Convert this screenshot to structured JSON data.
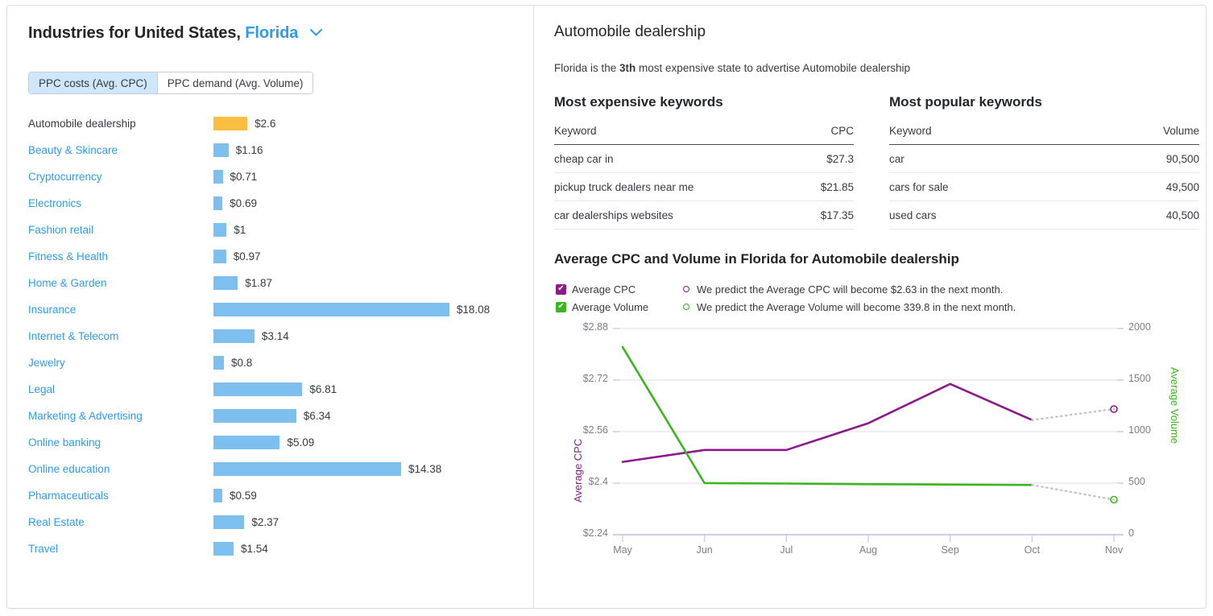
{
  "left": {
    "title_prefix": "Industries for United States,",
    "state": "Florida",
    "chevron_icon": "chevron-down-icon",
    "tabs": [
      {
        "label": "PPC costs (Avg. CPC)",
        "active": true
      },
      {
        "label": "PPC demand (Avg. Volume)",
        "active": false
      }
    ],
    "industries": [
      {
        "name": "Automobile dealership",
        "value": 2.6,
        "label": "$2.6",
        "current": true
      },
      {
        "name": "Beauty & Skincare",
        "value": 1.16,
        "label": "$1.16",
        "current": false
      },
      {
        "name": "Cryptocurrency",
        "value": 0.71,
        "label": "$0.71",
        "current": false
      },
      {
        "name": "Electronics",
        "value": 0.69,
        "label": "$0.69",
        "current": false
      },
      {
        "name": "Fashion retail",
        "value": 1,
        "label": "$1",
        "current": false
      },
      {
        "name": "Fitness & Health",
        "value": 0.97,
        "label": "$0.97",
        "current": false
      },
      {
        "name": "Home & Garden",
        "value": 1.87,
        "label": "$1.87",
        "current": false
      },
      {
        "name": "Insurance",
        "value": 18.08,
        "label": "$18.08",
        "current": false
      },
      {
        "name": "Internet & Telecom",
        "value": 3.14,
        "label": "$3.14",
        "current": false
      },
      {
        "name": "Jewelry",
        "value": 0.8,
        "label": "$0.8",
        "current": false
      },
      {
        "name": "Legal",
        "value": 6.81,
        "label": "$6.81",
        "current": false
      },
      {
        "name": "Marketing & Advertising",
        "value": 6.34,
        "label": "$6.34",
        "current": false
      },
      {
        "name": "Online banking",
        "value": 5.09,
        "label": "$5.09",
        "current": false
      },
      {
        "name": "Online education",
        "value": 14.38,
        "label": "$14.38",
        "current": false
      },
      {
        "name": "Pharmaceuticals",
        "value": 0.59,
        "label": "$0.59",
        "current": false
      },
      {
        "name": "Real Estate",
        "value": 2.37,
        "label": "$2.37",
        "current": false
      },
      {
        "name": "Travel",
        "value": 1.54,
        "label": "$1.54",
        "current": false
      }
    ],
    "colors": {
      "bar": "#7dc0ef",
      "bar_current": "#fbbf3f",
      "link": "#2e9bf0"
    }
  },
  "right": {
    "title": "Automobile dealership",
    "subtitle_before": "Florida is the ",
    "subtitle_rank": "3th",
    "subtitle_after": " most expensive state to advertise Automobile dealership",
    "expensive": {
      "heading": "Most expensive keywords",
      "columns": [
        "Keyword",
        "CPC"
      ],
      "rows": [
        {
          "keyword": "cheap car in",
          "value": "$27.3"
        },
        {
          "keyword": "pickup truck dealers near me",
          "value": "$21.85"
        },
        {
          "keyword": "car dealerships websites",
          "value": "$17.35"
        }
      ]
    },
    "popular": {
      "heading": "Most popular keywords",
      "columns": [
        "Keyword",
        "Volume"
      ],
      "rows": [
        {
          "keyword": "car",
          "value": "90,500"
        },
        {
          "keyword": "cars for sale",
          "value": "49,500"
        },
        {
          "keyword": "used cars",
          "value": "40,500"
        }
      ]
    }
  },
  "chart_data": {
    "type": "line",
    "title": "Average CPC and Volume in Florida for Automobile dealership",
    "x": [
      "May",
      "Jun",
      "Jul",
      "Aug",
      "Sep",
      "Oct",
      "Nov"
    ],
    "xlabel": "",
    "grid": true,
    "legend_position": "top-left",
    "legend": [
      {
        "name": "Average CPC",
        "color": "#8a1a89",
        "checked": true,
        "checkbox_icon": "check-icon"
      },
      {
        "name": "Average Volume",
        "color": "#3cb521",
        "checked": true,
        "checkbox_icon": "check-icon"
      }
    ],
    "forecasts": [
      {
        "marker_icon": "circle-outline-icon",
        "color": "#8a1a89",
        "text": "We predict the Average CPC will become $2.63 in the next month."
      },
      {
        "marker_icon": "circle-outline-icon",
        "color": "#3cb521",
        "text": "We predict the Average Volume will become 339.8 in the next month."
      }
    ],
    "y_left": {
      "title": "Average CPC",
      "color": "#8a1a89",
      "ticks": [
        "$2.24",
        "$2.4",
        "$2.56",
        "$2.72",
        "$2.88"
      ],
      "tickvals": [
        2.24,
        2.4,
        2.56,
        2.72,
        2.88
      ],
      "range": [
        2.24,
        2.88
      ]
    },
    "y_right": {
      "title": "Average Volume",
      "color": "#3cb521",
      "ticks": [
        "0",
        "500",
        "1000",
        "1500",
        "2000"
      ],
      "tickvals": [
        0,
        500,
        1000,
        1500,
        2000
      ],
      "range": [
        0,
        2000
      ]
    },
    "series": [
      {
        "name": "Average CPC",
        "axis": "left",
        "color": "#8a1a89",
        "values": [
          2.466,
          2.503,
          2.503,
          2.586,
          2.708,
          2.596
        ],
        "forecast": {
          "x": "Nov",
          "value": 2.63,
          "dashed": true,
          "marker": "circle-outline-icon"
        }
      },
      {
        "name": "Average Volume",
        "axis": "right",
        "color": "#3cb521",
        "values": [
          1820,
          500,
          496,
          490,
          486,
          482
        ],
        "forecast": {
          "x": "Nov",
          "value": 339.8,
          "dashed": true,
          "marker": "circle-outline-icon"
        }
      }
    ]
  }
}
